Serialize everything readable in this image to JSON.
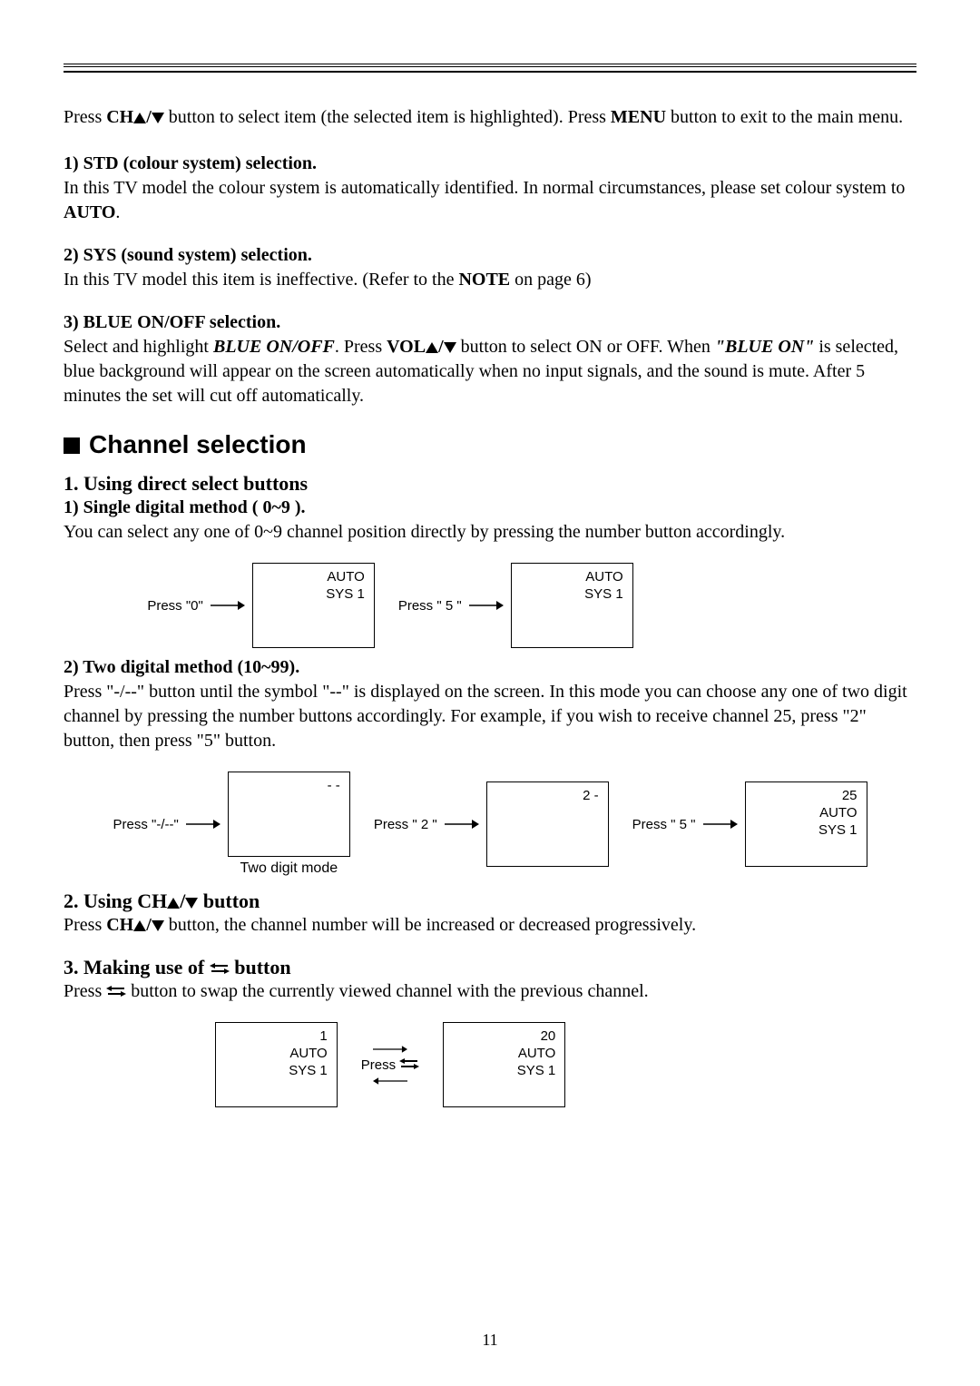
{
  "intro": {
    "line1_a": "Press ",
    "ch_b": "CH",
    "slash": "/",
    "line1_b": "  button  to select item (the selected item is highlighted). Press ",
    "menu_b": "MENU",
    "line1_c": " button to exit to the main menu."
  },
  "s1": {
    "heading": "1) STD (colour system) selection.",
    "text_a": "In this TV model the colour system is automatically identified. In normal circumstances, please set colour system to ",
    "auto_b": "AUTO",
    "text_b": "."
  },
  "s2": {
    "heading": "2) SYS (sound system) selection.",
    "text_a": "In this TV model this item is ineffective. (Refer to the ",
    "note_b": "NOTE",
    "text_b": " on page 6)"
  },
  "s3": {
    "heading": "3) BLUE ON/OFF selection.",
    "text_a": "Select and highlight ",
    "blue_bi": "BLUE ON/OFF",
    "text_b": ". Press ",
    "vol_b": "VOL",
    "text_c": " button to select ON or OFF. When ",
    "blueon_bi": "\"BLUE ON\"",
    "text_d": " is selected, blue background will appear on the screen automatically when no input signals, and the sound is mute. After 5 minutes the set will cut off automatically."
  },
  "chsel": {
    "title": "Channel selection",
    "h1": "1. Using direct select buttons",
    "m1": {
      "heading": "1) Single digital method ( 0~9 ).",
      "text": "You can select any one of 0~9 channel position directly by pressing the number button accordingly."
    },
    "d1": {
      "step1_label": "Press \"0\"",
      "screen1_l1": "AUTO",
      "screen1_l2": "SYS 1",
      "step2_label": "Press \" 5 \"",
      "screen2_l1": "AUTO",
      "screen2_l2": "SYS 1"
    },
    "m2": {
      "heading": "2) Two digital method (10~99).",
      "text": "Press  \"-/--\" button until the symbol \"--\" is displayed on the screen. In this mode you can choose any one of two digit channel by pressing the number buttons accordingly. For example, if you wish to receive channel 25, press \"2\" button, then press \"5\" button."
    },
    "d2": {
      "step1_label": "Press \"-/--\"",
      "screen1_l1": "- -",
      "subcaption": "Two digit mode",
      "step2_label": "Press \" 2 \"",
      "screen2_l1": "2 -",
      "step3_label": "Press \" 5 \"",
      "screen3_l1": "25",
      "screen3_l2": "AUTO",
      "screen3_l3": "SYS 1"
    },
    "h2_a": "2. Using CH",
    "h2_slash": "/",
    "h2_b": " button",
    "h2_text_a": "Press ",
    "h2_ch_b": "CH",
    "h2_text_b": " button, the channel number will be increased or decreased progressively.",
    "h3_a": "3. Making use of ",
    "h3_b": " button",
    "h3_text_a": "Press ",
    "h3_text_b": " button to swap the currently viewed channel with the previous channel.",
    "d3": {
      "screen1_l1": "1",
      "screen1_l2": "AUTO",
      "screen1_l3": "SYS 1",
      "step_label": "Press ",
      "screen2_l1": "20",
      "screen2_l2": "AUTO",
      "screen2_l3": "SYS 1"
    }
  },
  "page_number": "11"
}
